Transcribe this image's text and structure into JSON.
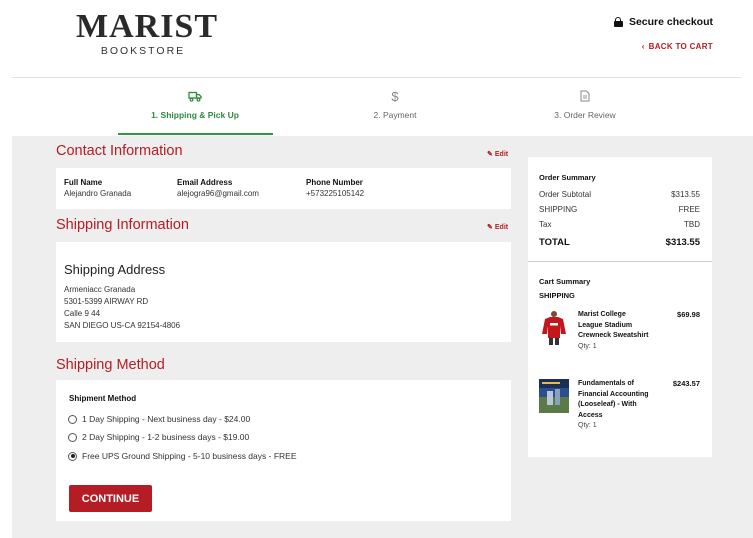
{
  "header": {
    "logo_main": "MARIST",
    "logo_sub": "BOOKSTORE",
    "secure_label": "Secure checkout",
    "back_to_cart": "BACK TO CART"
  },
  "steps": [
    {
      "label": "1. Shipping & Pick Up",
      "icon": "truck-icon",
      "active": true
    },
    {
      "label": "2. Payment",
      "icon": "dollar-icon",
      "active": false
    },
    {
      "label": "3. Order Review",
      "icon": "document-icon",
      "active": false
    }
  ],
  "contact": {
    "title": "Contact Information",
    "edit": "Edit",
    "full_name_label": "Full Name",
    "full_name": "Alejandro Granada",
    "email_label": "Email Address",
    "email": "alejogra96@gmail.com",
    "phone_label": "Phone Number",
    "phone": "+573225105142"
  },
  "shipping_info": {
    "title": "Shipping Information",
    "edit": "Edit",
    "address_title": "Shipping Address",
    "lines": [
      "Armeniacc Granada",
      "5301-5399 AIRWAY RD",
      "Calle 9 44",
      "SAN DIEGO US-CA 92154-4806"
    ]
  },
  "shipping_method": {
    "title": "Shipping Method",
    "subtitle": "Shipment Method",
    "options": [
      {
        "label": "1 Day Shipping  - Next business day  - $24.00",
        "checked": false
      },
      {
        "label": "2 Day Shipping  - 1-2 business days  - $19.00",
        "checked": false
      },
      {
        "label": "Free UPS Ground Shipping  - 5-10 business days  - FREE",
        "checked": true
      }
    ],
    "continue_label": "CONTINUE"
  },
  "order_summary": {
    "title": "Order Summary",
    "rows": [
      {
        "label": "Order Subtotal",
        "value": "$313.55"
      },
      {
        "label": "SHIPPING",
        "value": "FREE"
      },
      {
        "label": "Tax",
        "value": "TBD"
      }
    ],
    "total_label": "TOTAL",
    "total_value": "$313.55"
  },
  "cart_summary": {
    "title": "Cart Summary",
    "shipping_label": "SHIPPING",
    "items": [
      {
        "name": "Marist College League Stadium Crewneck Sweatshirt",
        "qty": "Qty: 1",
        "price": "$69.98"
      },
      {
        "name": "Fundamentals of Financial Accounting (Looseleaf) - With Access",
        "qty": "Qty: 1",
        "price": "$243.57"
      }
    ]
  },
  "colors": {
    "brand_red": "#b51c24",
    "active_green": "#2e9a45",
    "gray_bg": "#eeeeee"
  }
}
